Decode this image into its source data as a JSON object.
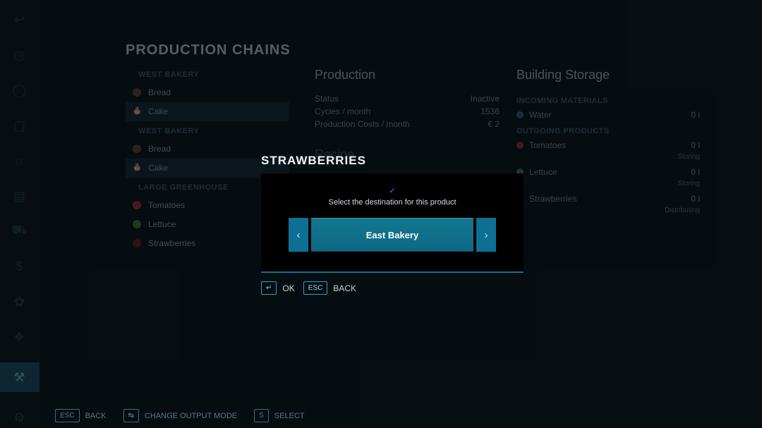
{
  "page_title": "PRODUCTION CHAINS",
  "leftbar": {
    "icons": [
      {
        "name": "back-icon",
        "glyph": "↩"
      },
      {
        "name": "globe-icon",
        "glyph": "◎"
      },
      {
        "name": "steer-icon",
        "glyph": "◯"
      },
      {
        "name": "calendar-icon",
        "glyph": "▢"
      },
      {
        "name": "weather-icon",
        "glyph": "☼"
      },
      {
        "name": "stats-icon",
        "glyph": "▤"
      },
      {
        "name": "vehicle-icon",
        "glyph": "⛟"
      },
      {
        "name": "finance-icon",
        "glyph": "$"
      },
      {
        "name": "animals-icon",
        "glyph": "✿"
      },
      {
        "name": "contracts-icon",
        "glyph": "❖"
      },
      {
        "name": "production-icon",
        "glyph": "⚒",
        "active": true
      },
      {
        "name": "settings-icon",
        "glyph": "⚙"
      }
    ]
  },
  "chains": {
    "groups": [
      {
        "label": "WEST BAKERY",
        "items": [
          {
            "label": "Bread",
            "dot": "dot-brown"
          },
          {
            "label": "Cake",
            "dot": "",
            "selected": true
          }
        ]
      },
      {
        "label": "WEST BAKERY",
        "items": [
          {
            "label": "Bread",
            "dot": "dot-brown"
          },
          {
            "label": "Cake",
            "dot": "",
            "selected": true
          }
        ]
      },
      {
        "label": "LARGE GREENHOUSE",
        "items": [
          {
            "label": "Tomatoes",
            "dot": "dot-red"
          },
          {
            "label": "Lettuce",
            "dot": "dot-green"
          },
          {
            "label": "Strawberries",
            "dot": "dot-darkred"
          }
        ]
      }
    ]
  },
  "production": {
    "heading": "Production",
    "rows": [
      {
        "k": "Status",
        "v": "Inactive"
      },
      {
        "k": "Cycles / month",
        "v": "1536"
      },
      {
        "k": "Production Costs / month",
        "v": "€ 2"
      }
    ],
    "recipe_heading": "Recipe"
  },
  "storage": {
    "heading": "Building Storage",
    "incoming_label": "INCOMING MATERIALS",
    "incoming": [
      {
        "name": "Water",
        "amount": "0 l",
        "dot": "dot-blue"
      }
    ],
    "outgoing_label": "OUTGOING PRODUCTS",
    "outgoing": [
      {
        "name": "Tomatoes",
        "amount": "0 l",
        "sub": "Storing",
        "dot": "dot-red"
      },
      {
        "name": "Lettuce",
        "amount": "0 l",
        "sub": "Storing",
        "dot": "dot-green"
      },
      {
        "name": "Strawberries",
        "amount": "0 l",
        "sub": "Distributing",
        "dot": "dot-darkred"
      }
    ]
  },
  "modal": {
    "title": "STRAWBERRIES",
    "instruction": "Select the destination for this product",
    "selected": "East Bakery",
    "ok_key": "↵",
    "ok_label": "OK",
    "back_key": "ESC",
    "back_label": "BACK"
  },
  "bottombar": {
    "items": [
      {
        "key": "ESC",
        "label": "BACK"
      },
      {
        "key": "↹",
        "label": "CHANGE OUTPUT MODE"
      },
      {
        "key": "S",
        "label": "SELECT"
      }
    ]
  }
}
